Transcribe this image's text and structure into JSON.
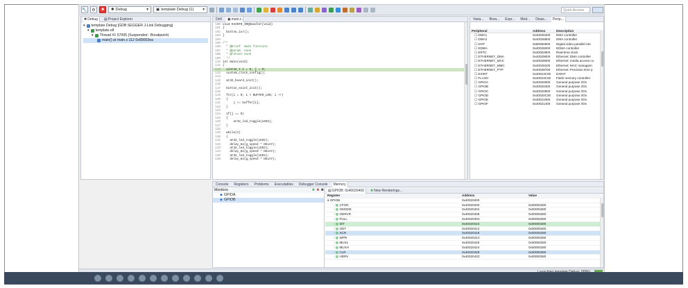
{
  "toolbar": {
    "debug_combo": "Debug",
    "launch_combo": "template Debug (1)",
    "quick_access": "Quick Access"
  },
  "debug_view": {
    "tabs": [
      "Debug",
      "Project Explorer"
    ],
    "items": [
      "template Debug [GDB SEGGER J-Link Debugging]",
      "template.elf",
      "Thread #1 57005 (Suspended : Breakpoint)",
      "main() at main.c:112 0x80003ea"
    ]
  },
  "editor": {
    "tabs": [
      "Defi",
      "main.c"
    ],
    "lines": [
      {
        "n": "100",
        "t": "void EXINT0_IRQHandler(void)"
      },
      {
        "n": "101",
        "t": "{"
      },
      {
        "n": "102",
        "t": "  button_isr();"
      },
      {
        "n": "103",
        "t": "}"
      },
      {
        "n": "104",
        "t": ""
      },
      {
        "n": "105",
        "t": "/**"
      },
      {
        "n": "106",
        "t": "  * @brief  main function."
      },
      {
        "n": "107",
        "t": "  * @param  none"
      },
      {
        "n": "108",
        "t": "  * @retval none"
      },
      {
        "n": "109",
        "t": "  */"
      },
      {
        "n": "110",
        "t": "int main(void)"
      },
      {
        "n": "111",
        "t": "{"
      },
      {
        "n": "112",
        "t": "  uint32_t i = 0, j = 0;"
      },
      {
        "n": "113",
        "t": "  system_clock_config();"
      },
      {
        "n": "114",
        "t": ""
      },
      {
        "n": "115",
        "t": "  at32_board_init();"
      },
      {
        "n": "116",
        "t": ""
      },
      {
        "n": "117",
        "t": "  button_exint_init();"
      },
      {
        "n": "118",
        "t": ""
      },
      {
        "n": "119",
        "t": "  for(i = 0; i < BUFFER_LEN; i ++)"
      },
      {
        "n": "120",
        "t": "  {"
      },
      {
        "n": "121",
        "t": "      j += buffer[i];"
      },
      {
        "n": "122",
        "t": "  }"
      },
      {
        "n": "123",
        "t": ""
      },
      {
        "n": "124",
        "t": "  if(j == 0)"
      },
      {
        "n": "125",
        "t": "  {"
      },
      {
        "n": "126",
        "t": "      at32_led_toggle(LED2);"
      },
      {
        "n": "127",
        "t": "  }"
      },
      {
        "n": "128",
        "t": ""
      },
      {
        "n": "129",
        "t": "  while(1)"
      },
      {
        "n": "130",
        "t": "  {"
      },
      {
        "n": "131",
        "t": "    at32_led_toggle(LED2);"
      },
      {
        "n": "132",
        "t": "    delay_ms(g_speed * DELAY);"
      },
      {
        "n": "133",
        "t": "    at32_led_toggle(LED3);"
      },
      {
        "n": "134",
        "t": "    delay_ms(g_speed * DELAY);"
      },
      {
        "n": "135",
        "t": "    at32_led_toggle(LED4);"
      },
      {
        "n": "136",
        "t": "    delay_ms(g_speed * DELAY);"
      }
    ]
  },
  "periph": {
    "tabs": [
      "Varia...",
      "Brea...",
      "Expr...",
      "Mod...",
      "Disas...",
      "Perip..."
    ],
    "headers": [
      "Peripheral",
      "Address",
      "Description"
    ],
    "rows": [
      {
        "name": "DMA1",
        "addr": "0x40026400",
        "desc": "DMA controller"
      },
      {
        "name": "DMA2",
        "addr": "0x40026800",
        "desc": "DMA controller"
      },
      {
        "name": "DVP",
        "addr": "0x50050000",
        "desc": "Digital video parallel inte"
      },
      {
        "name": "EDMA",
        "addr": "0x40026000",
        "desc": "EDMA controller"
      },
      {
        "name": "ERTC",
        "addr": "0x40002800",
        "desc": "Real-time clock"
      },
      {
        "name": "ETHERNET_DMA",
        "addr": "0x40029000",
        "desc": "Ethernet: DMA controller"
      },
      {
        "name": "ETHERNET_MAC",
        "addr": "0x40028000",
        "desc": "Ethernet: media access co"
      },
      {
        "name": "ETHERNET_MMC",
        "addr": "0x40028100",
        "desc": "Ethernet: MAC managem"
      },
      {
        "name": "ETHERNET_PTP",
        "addr": "0x40028700",
        "desc": "Ethernet: Precision time p"
      },
      {
        "name": "EXINT",
        "addr": "0x40013C00",
        "desc": "EXINT"
      },
      {
        "name": "FLASH",
        "addr": "0x40023C00",
        "desc": "Flash memory controller"
      },
      {
        "name": "GPIOA",
        "addr": "0x40020000",
        "desc": "General purpose I/Os"
      },
      {
        "name": "GPIOB",
        "addr": "0x40020400",
        "desc": "General purpose I/Os"
      },
      {
        "name": "GPIOC",
        "addr": "0x40020800",
        "desc": "General purpose I/Os"
      },
      {
        "name": "GPIOD",
        "addr": "0x40020C00",
        "desc": "General purpose I/Os"
      },
      {
        "name": "GPIOE",
        "addr": "0x40021000",
        "desc": "General purpose I/Os"
      },
      {
        "name": "GPIOF",
        "addr": "0x40021400",
        "desc": "General purpose I/Os"
      }
    ]
  },
  "bottom": {
    "tabs": [
      "Console",
      "Registers",
      "Problems",
      "Executables",
      "Debugger Console",
      "Memory"
    ],
    "monitors_label": "Monitors",
    "monitors": [
      "GPIOA",
      "GPIOB"
    ],
    "rendering_tabs": [
      "GPIOB: 0x40020400",
      "New Renderings..."
    ],
    "headers": [
      "Register",
      "Address",
      "Value"
    ],
    "group": {
      "name": "GPIOB",
      "addr": "0x40020400"
    },
    "rows": [
      {
        "name": "CFGR",
        "addr": "0x40020400",
        "val": "0x00000280",
        "hl": ""
      },
      {
        "name": "OMODE",
        "addr": "0x40020404",
        "val": "0x00000280",
        "hl": ""
      },
      {
        "name": "ODRVR",
        "addr": "0x40020408",
        "val": "0x00000280",
        "hl": ""
      },
      {
        "name": "PULL",
        "addr": "0x4002040C",
        "val": "0x00000280",
        "hl": ""
      },
      {
        "name": "IDT",
        "addr": "0x40020410",
        "val": "0x00000280",
        "hl": "green"
      },
      {
        "name": "ODT",
        "addr": "0x40020414",
        "val": "0x00000280",
        "hl": ""
      },
      {
        "name": "SCR",
        "addr": "0x40020418",
        "val": "0x00000280",
        "hl": "blue"
      },
      {
        "name": "WPR",
        "addr": "0x4002041C",
        "val": "0x00000280",
        "hl": ""
      },
      {
        "name": "MUXL",
        "addr": "0x40020420",
        "val": "0x00000280",
        "hl": ""
      },
      {
        "name": "MUXH",
        "addr": "0x40020424",
        "val": "0x00000280",
        "hl": ""
      },
      {
        "name": "CLR",
        "addr": "0x40020428",
        "val": "0x00000280",
        "hl": "blue"
      },
      {
        "name": "HDRV",
        "addr": "0x4002043C",
        "val": "0x00000280",
        "hl": ""
      }
    ]
  },
  "status": {
    "launching": "Launching template Debug: (99%)"
  }
}
